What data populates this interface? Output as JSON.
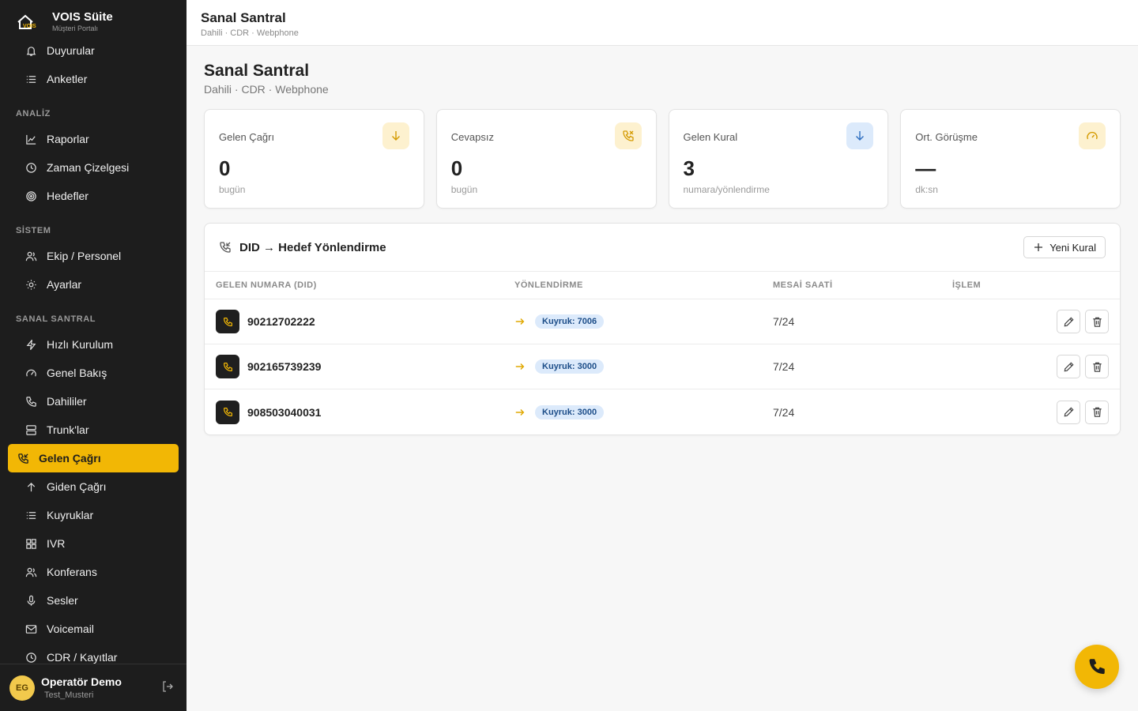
{
  "brand": {
    "title": "VOIS Süite",
    "subtitle": "Müşteri Portalı",
    "logo_text": "VOIS"
  },
  "sidebar": {
    "items_top": [
      {
        "label": "Duyurular",
        "icon": "bell-icon"
      },
      {
        "label": "Anketler",
        "icon": "list-icon"
      }
    ],
    "sections": [
      {
        "title": "ANALİZ",
        "items": [
          {
            "label": "Raporlar",
            "icon": "chart-line-icon"
          },
          {
            "label": "Zaman Çizelgesi",
            "icon": "clock-icon"
          },
          {
            "label": "Hedefler",
            "icon": "target-icon"
          }
        ]
      },
      {
        "title": "SİSTEM",
        "items": [
          {
            "label": "Ekip / Personel",
            "icon": "users-icon"
          },
          {
            "label": "Ayarlar",
            "icon": "sun-settings-icon"
          }
        ]
      },
      {
        "title": "SANAL SANTRAL",
        "items": [
          {
            "label": "Hızlı Kurulum",
            "icon": "bolt-icon"
          },
          {
            "label": "Genel Bakış",
            "icon": "gauge-icon"
          },
          {
            "label": "Dahililer",
            "icon": "phone-icon"
          },
          {
            "label": "Trunk'lar",
            "icon": "server-icon"
          },
          {
            "label": "Gelen Çağrı",
            "icon": "phone-incoming-icon",
            "active": true
          },
          {
            "label": "Giden Çağrı",
            "icon": "arrow-up-icon"
          },
          {
            "label": "Kuyruklar",
            "icon": "list-icon"
          },
          {
            "label": "IVR",
            "icon": "grid-icon"
          },
          {
            "label": "Konferans",
            "icon": "users-icon"
          },
          {
            "label": "Sesler",
            "icon": "mic-icon"
          },
          {
            "label": "Voicemail",
            "icon": "mail-icon"
          },
          {
            "label": "CDR / Kayıtlar",
            "icon": "history-icon"
          }
        ]
      }
    ]
  },
  "user": {
    "initials": "EG",
    "name": "Operatör Demo",
    "org": "Test_Musteri"
  },
  "header": {
    "title": "Sanal Santral",
    "breadcrumb": "Dahili · CDR · Webphone"
  },
  "page": {
    "title": "Sanal Santral",
    "subtitle": "Dahili · CDR · Webphone"
  },
  "cards": [
    {
      "label": "Gelen Çağrı",
      "value": "0",
      "hint": "bugün",
      "icon": "arrow-down-icon"
    },
    {
      "label": "Cevapsız",
      "value": "0",
      "hint": "bugün",
      "icon": "phone-missed-icon"
    },
    {
      "label": "Gelen Kural",
      "value": "3",
      "hint": "numara/yönlendirme",
      "icon": "arrow-down-icon"
    },
    {
      "label": "Ort. Görüşme",
      "value": "—",
      "hint": "dk:sn",
      "icon": "gauge-icon"
    }
  ],
  "panel": {
    "title": "DID → Hedef Yönlendirme",
    "new_button": "Yeni Kural",
    "columns": [
      "GELEN NUMARA (DID)",
      "YÖNLENDİRME",
      "MESAİ SAATİ",
      "İŞLEM"
    ],
    "rows": [
      {
        "number": "90212702222",
        "target": "Kuyruk: 7006",
        "hours": "7/24"
      },
      {
        "number": "902165739239",
        "target": "Kuyruk: 3000",
        "hours": "7/24"
      },
      {
        "number": "908503040031",
        "target": "Kuyruk: 3000",
        "hours": "7/24"
      }
    ]
  },
  "colors": {
    "accent": "#f2b705",
    "sidebar_bg": "#1d1d1d",
    "badge_bg": "#dceafb"
  }
}
